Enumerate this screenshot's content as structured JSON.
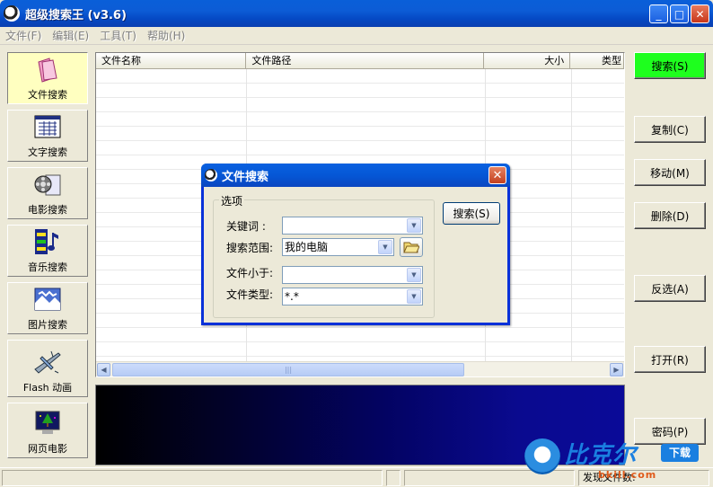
{
  "window": {
    "title": "超级搜索王 (v3.6)",
    "minimize": "_",
    "maximize": "□",
    "close": "✕"
  },
  "menu": [
    {
      "label": "文件(F)"
    },
    {
      "label": "编辑(E)"
    },
    {
      "label": "工具(T)"
    },
    {
      "label": "帮助(H)"
    }
  ],
  "sidebar": [
    {
      "label": "文件搜索",
      "icon": "folder-icon",
      "active": true
    },
    {
      "label": "文字搜索",
      "icon": "text-grid-icon"
    },
    {
      "label": "电影搜索",
      "icon": "film-reel-icon"
    },
    {
      "label": "音乐搜索",
      "icon": "music-note-icon"
    },
    {
      "label": "图片搜索",
      "icon": "picture-icon"
    },
    {
      "label": "Flash 动画",
      "icon": "flash-plane-icon"
    },
    {
      "label": "网页电影",
      "icon": "monitor-tree-icon"
    }
  ],
  "list": {
    "columns": [
      "文件名称",
      "文件路径",
      "大小",
      "类型"
    ]
  },
  "actions": {
    "search": "搜索(S)",
    "copy": "复制(C)",
    "move": "移动(M)",
    "delete": "删除(D)",
    "invert": "反选(A)",
    "open": "打开(R)",
    "password": "密码(P)"
  },
  "dialog": {
    "title": "文件搜索",
    "group_label": "选项",
    "keyword_label": "关键词 :",
    "keyword_value": "",
    "scope_label": "搜索范围:",
    "scope_value": "我的电脑",
    "size_label": "文件小于:",
    "size_value": "",
    "type_label": "文件类型:",
    "type_value": "*.*",
    "search_button": "搜索(S)",
    "close": "✕"
  },
  "statusbar": {
    "text": "发现文件数:"
  },
  "watermark": {
    "main": "比克尔",
    "download": "下载",
    "url": "bkill.com"
  }
}
